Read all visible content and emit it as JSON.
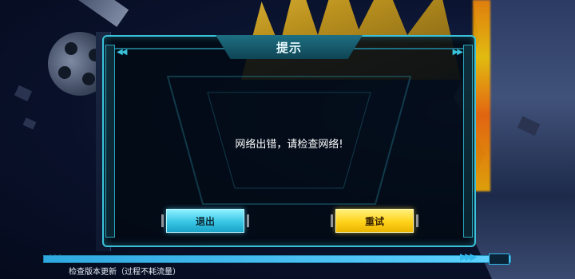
{
  "dialog": {
    "title": "提示",
    "message": "网络出错，请检查网络!",
    "buttons": {
      "exit_label": "退出",
      "retry_label": "重试"
    }
  },
  "footer": {
    "status_text": "检查版本更新（过程不耗流量）",
    "progress": 1.0
  },
  "colors": {
    "accent": "#39c2d9",
    "exit_button": "#38c6e6",
    "retry_button": "#ffd21a",
    "dialog_bg": "#020a14"
  },
  "icons": [
    "chevron-left-icon",
    "chevron-right-icon"
  ]
}
